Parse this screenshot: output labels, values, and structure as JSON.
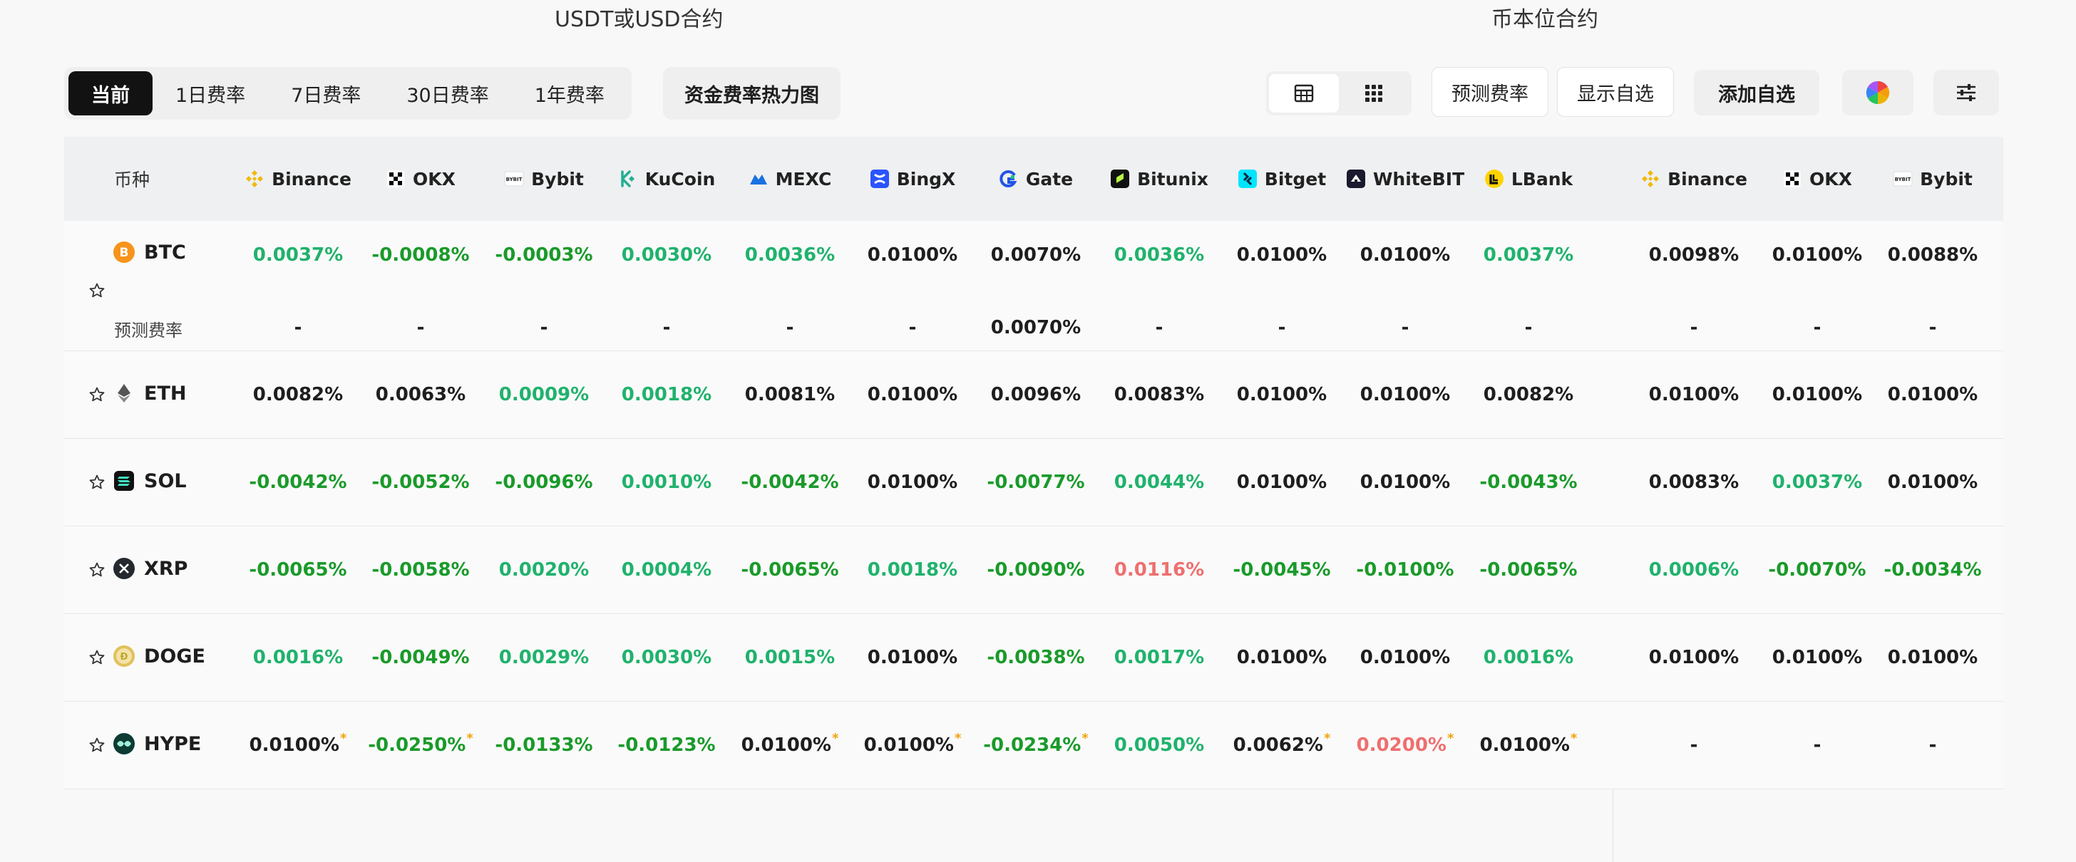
{
  "sections": {
    "usdt": "USDT或USD合约",
    "coin": "币本位合约"
  },
  "tabs": [
    {
      "label": "当前",
      "active": true
    },
    {
      "label": "1日费率",
      "active": false
    },
    {
      "label": "7日费率",
      "active": false
    },
    {
      "label": "30日费率",
      "active": false
    },
    {
      "label": "1年费率",
      "active": false
    }
  ],
  "heatmap_label": "资金费率热力图",
  "predict_label": "预测费率",
  "show_fav_label": "显示自选",
  "add_fav_label": "添加自选",
  "coin_header": "币种",
  "predicted_label": "预测费率",
  "exchanges": [
    {
      "name": "Binance",
      "icon": "binance-icon",
      "color": "#f0b90b"
    },
    {
      "name": "OKX",
      "icon": "okx-icon",
      "color": "#000000"
    },
    {
      "name": "Bybit",
      "icon": "bybit-icon",
      "color": "#222222"
    },
    {
      "name": "KuCoin",
      "icon": "kucoin-icon",
      "color": "#23af91"
    },
    {
      "name": "MEXC",
      "icon": "mexc-icon",
      "color": "#1972e2"
    },
    {
      "name": "BingX",
      "icon": "bingx-icon",
      "color": "#2a54ff"
    },
    {
      "name": "Gate",
      "icon": "gate-icon",
      "color": "#2354e6"
    },
    {
      "name": "Bitunix",
      "icon": "bitunix-icon",
      "color": "#b9f641"
    },
    {
      "name": "Bitget",
      "icon": "bitget-icon",
      "color": "#00e5ff"
    },
    {
      "name": "WhiteBIT",
      "icon": "whitebit-icon",
      "color": "#1a1a2e"
    },
    {
      "name": "LBank",
      "icon": "lbank-icon",
      "color": "#ffd400"
    },
    {
      "name": "Binance",
      "icon": "binance-icon",
      "color": "#f0b90b"
    },
    {
      "name": "OKX",
      "icon": "okx-icon",
      "color": "#000000"
    },
    {
      "name": "Bybit",
      "icon": "bybit-icon",
      "color": "#222222"
    }
  ],
  "rows": [
    {
      "coin": "BTC",
      "icon": "btc-icon",
      "color": "#f7931a",
      "rates": [
        [
          "0.0037%",
          "pos"
        ],
        [
          "-0.0008%",
          "neg"
        ],
        [
          "-0.0003%",
          "neg"
        ],
        [
          "0.0030%",
          "pos"
        ],
        [
          "0.0036%",
          "pos"
        ],
        [
          "0.0100%",
          "neu"
        ],
        [
          "0.0070%",
          "neu"
        ],
        [
          "0.0036%",
          "pos"
        ],
        [
          "0.0100%",
          "neu"
        ],
        [
          "0.0100%",
          "neu"
        ],
        [
          "0.0037%",
          "pos"
        ],
        [
          "0.0098%",
          "neu"
        ],
        [
          "0.0100%",
          "neu"
        ],
        [
          "0.0088%",
          "neu"
        ]
      ],
      "predicted": [
        "-",
        "-",
        "-",
        "-",
        "-",
        "-",
        "0.0070%",
        "-",
        "-",
        "-",
        "-",
        "-",
        "-",
        "-"
      ]
    },
    {
      "coin": "ETH",
      "icon": "eth-icon",
      "color": "#444444",
      "rates": [
        [
          "0.0082%",
          "neu"
        ],
        [
          "0.0063%",
          "neu"
        ],
        [
          "0.0009%",
          "pos"
        ],
        [
          "0.0018%",
          "pos"
        ],
        [
          "0.0081%",
          "neu"
        ],
        [
          "0.0100%",
          "neu"
        ],
        [
          "0.0096%",
          "neu"
        ],
        [
          "0.0083%",
          "neu"
        ],
        [
          "0.0100%",
          "neu"
        ],
        [
          "0.0100%",
          "neu"
        ],
        [
          "0.0082%",
          "neu"
        ],
        [
          "0.0100%",
          "neu"
        ],
        [
          "0.0100%",
          "neu"
        ],
        [
          "0.0100%",
          "neu"
        ]
      ]
    },
    {
      "coin": "SOL",
      "icon": "sol-icon",
      "color": "#111111",
      "rates": [
        [
          "-0.0042%",
          "neg"
        ],
        [
          "-0.0052%",
          "neg"
        ],
        [
          "-0.0096%",
          "neg"
        ],
        [
          "0.0010%",
          "pos"
        ],
        [
          "-0.0042%",
          "neg"
        ],
        [
          "0.0100%",
          "neu"
        ],
        [
          "-0.0077%",
          "neg"
        ],
        [
          "0.0044%",
          "pos"
        ],
        [
          "0.0100%",
          "neu"
        ],
        [
          "0.0100%",
          "neu"
        ],
        [
          "-0.0043%",
          "neg"
        ],
        [
          "0.0083%",
          "neu"
        ],
        [
          "0.0037%",
          "pos"
        ],
        [
          "0.0100%",
          "neu"
        ]
      ]
    },
    {
      "coin": "XRP",
      "icon": "xrp-icon",
      "color": "#23292f",
      "rates": [
        [
          "-0.0065%",
          "neg"
        ],
        [
          "-0.0058%",
          "neg"
        ],
        [
          "0.0020%",
          "pos"
        ],
        [
          "0.0004%",
          "pos"
        ],
        [
          "-0.0065%",
          "neg"
        ],
        [
          "0.0018%",
          "pos"
        ],
        [
          "-0.0090%",
          "neg"
        ],
        [
          "0.0116%",
          "red"
        ],
        [
          "-0.0045%",
          "neg"
        ],
        [
          "-0.0100%",
          "neg"
        ],
        [
          "-0.0065%",
          "neg"
        ],
        [
          "0.0006%",
          "pos"
        ],
        [
          "-0.0070%",
          "neg"
        ],
        [
          "-0.0034%",
          "neg"
        ]
      ]
    },
    {
      "coin": "DOGE",
      "icon": "doge-icon",
      "color": "#c2a633",
      "rates": [
        [
          "0.0016%",
          "pos"
        ],
        [
          "-0.0049%",
          "neg"
        ],
        [
          "0.0029%",
          "pos"
        ],
        [
          "0.0030%",
          "pos"
        ],
        [
          "0.0015%",
          "pos"
        ],
        [
          "0.0100%",
          "neu"
        ],
        [
          "-0.0038%",
          "neg"
        ],
        [
          "0.0017%",
          "pos"
        ],
        [
          "0.0100%",
          "neu"
        ],
        [
          "0.0100%",
          "neu"
        ],
        [
          "0.0016%",
          "pos"
        ],
        [
          "0.0100%",
          "neu"
        ],
        [
          "0.0100%",
          "neu"
        ],
        [
          "0.0100%",
          "neu"
        ]
      ]
    },
    {
      "coin": "HYPE",
      "icon": "hype-icon",
      "color": "#0c3b34",
      "rates": [
        [
          "0.0100%",
          "neu",
          "*"
        ],
        [
          "-0.0250%",
          "neg",
          "*"
        ],
        [
          "-0.0133%",
          "neg"
        ],
        [
          "-0.0123%",
          "neg"
        ],
        [
          "0.0100%",
          "neu",
          "*"
        ],
        [
          "0.0100%",
          "neu",
          "*"
        ],
        [
          "-0.0234%",
          "neg",
          "*"
        ],
        [
          "0.0050%",
          "pos"
        ],
        [
          "0.0062%",
          "neu",
          "*"
        ],
        [
          "0.0200%",
          "red",
          "*"
        ],
        [
          "0.0100%",
          "neu",
          "*"
        ],
        [
          "-",
          "dash"
        ],
        [
          "-",
          "dash"
        ],
        [
          "-",
          "dash"
        ]
      ]
    }
  ]
}
